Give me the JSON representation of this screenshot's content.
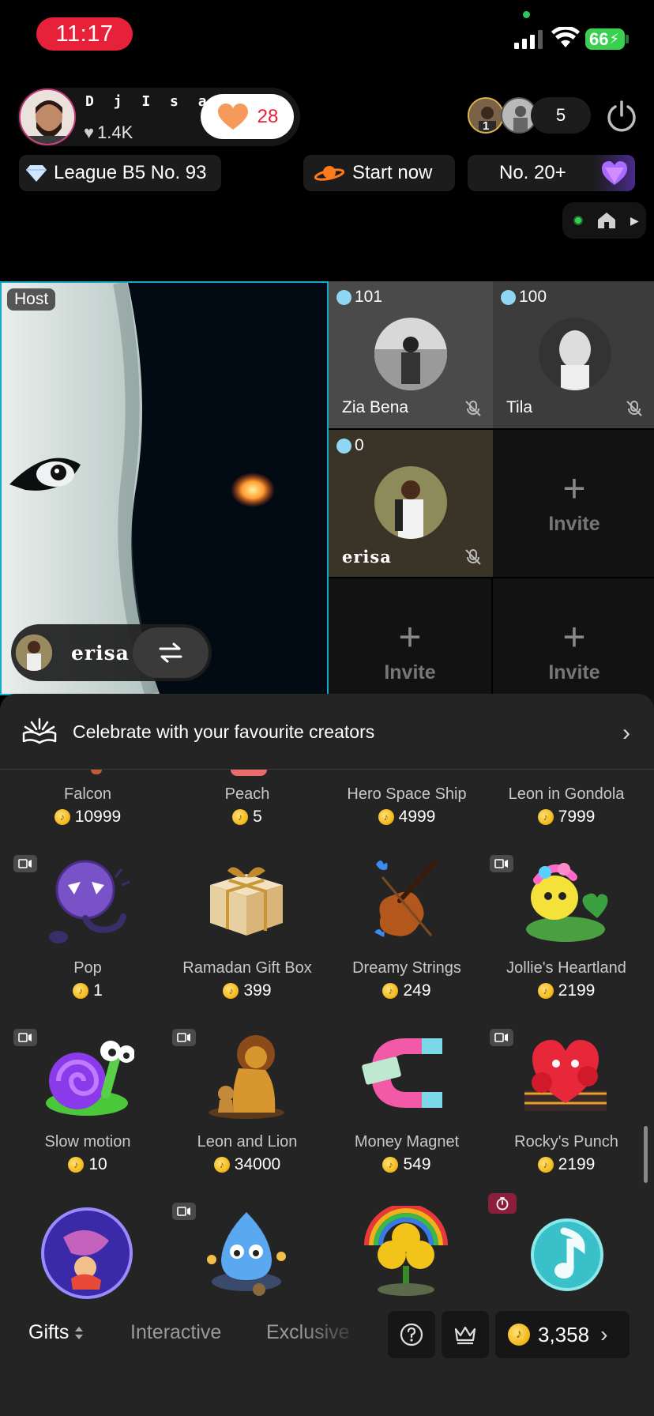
{
  "status_bar": {
    "time": "11:17",
    "battery": "66"
  },
  "host": {
    "name": "D j  I s a  T m",
    "likes": "1.4K",
    "follow_count": "28"
  },
  "viewers": {
    "count": "5",
    "top_rank": "1"
  },
  "chips": {
    "league": "League B5 No. 93",
    "start": "Start now",
    "rank": "No. 20+"
  },
  "host_tile": {
    "tag": "Host",
    "guest_name": "erisa"
  },
  "guests": [
    {
      "score": "101",
      "name": "Zia Bena"
    },
    {
      "score": "100",
      "name": "Tila"
    },
    {
      "score": "0",
      "name": "erisa"
    }
  ],
  "invite_label": "Invite",
  "banner": {
    "text": "Celebrate with your favourite creators"
  },
  "gifts_row0": [
    {
      "name": "Falcon",
      "price": "10999"
    },
    {
      "name": "Peach",
      "price": "5"
    },
    {
      "name": "Hero Space Ship",
      "price": "4999"
    },
    {
      "name": "Leon in Gondola",
      "price": "7999"
    }
  ],
  "gifts_row1": [
    {
      "name": "Pop",
      "price": "1"
    },
    {
      "name": "Ramadan Gift Box",
      "price": "399"
    },
    {
      "name": "Dreamy Strings",
      "price": "249"
    },
    {
      "name": "Jollie's Heartland",
      "price": "2199"
    }
  ],
  "gifts_row2": [
    {
      "name": "Slow motion",
      "price": "10"
    },
    {
      "name": "Leon and Lion",
      "price": "34000"
    },
    {
      "name": "Money Magnet",
      "price": "549"
    },
    {
      "name": "Rocky's Punch",
      "price": "2199"
    }
  ],
  "tabs": {
    "gifts": "Gifts",
    "interactive": "Interactive",
    "exclusive": "Exclusive"
  },
  "balance": "3,358"
}
